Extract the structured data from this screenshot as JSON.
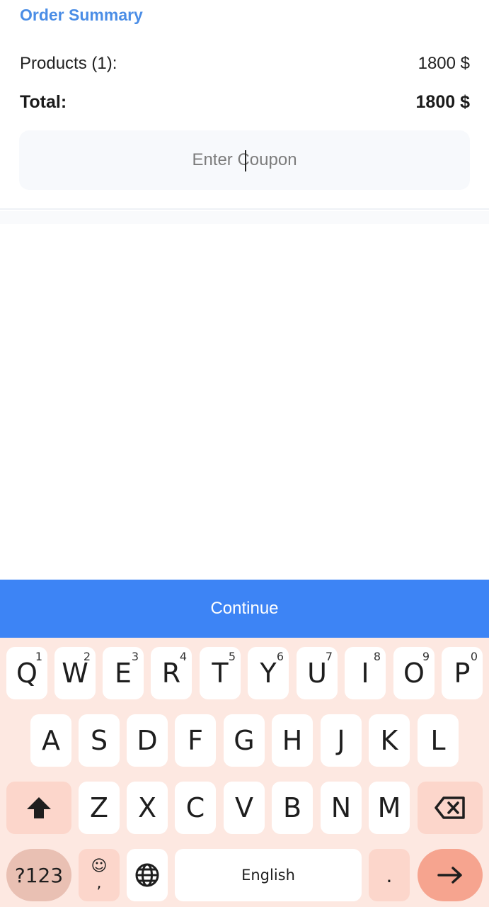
{
  "header": {
    "title": "Order Summary"
  },
  "summary": {
    "products_label": "Products (1):",
    "products_value": "1800 $",
    "total_label": "Total:",
    "total_value": "1800 $",
    "coupon_placeholder": "Enter Coupon"
  },
  "continue_label": "Continue",
  "keyboard": {
    "row1": [
      {
        "key": "Q",
        "hint": "1"
      },
      {
        "key": "W",
        "hint": "2"
      },
      {
        "key": "E",
        "hint": "3"
      },
      {
        "key": "R",
        "hint": "4"
      },
      {
        "key": "T",
        "hint": "5"
      },
      {
        "key": "Y",
        "hint": "6"
      },
      {
        "key": "U",
        "hint": "7"
      },
      {
        "key": "I",
        "hint": "8"
      },
      {
        "key": "O",
        "hint": "9"
      },
      {
        "key": "P",
        "hint": "0"
      }
    ],
    "row2": [
      "A",
      "S",
      "D",
      "F",
      "G",
      "H",
      "J",
      "K",
      "L"
    ],
    "row3": [
      "Z",
      "X",
      "C",
      "V",
      "B",
      "N",
      "M"
    ],
    "symbols_label": "?123",
    "emoji_top": "☺",
    "emoji_bottom": ",",
    "space_label": "English",
    "period_label": ".",
    "icons": {
      "shift": "shift-icon",
      "backspace": "backspace-icon",
      "globe": "globe-icon",
      "enter": "arrow-right-icon"
    }
  },
  "colors": {
    "accent": "#3d84f5",
    "title": "#4a8de6",
    "keyboard_bg": "#fde8e1"
  }
}
